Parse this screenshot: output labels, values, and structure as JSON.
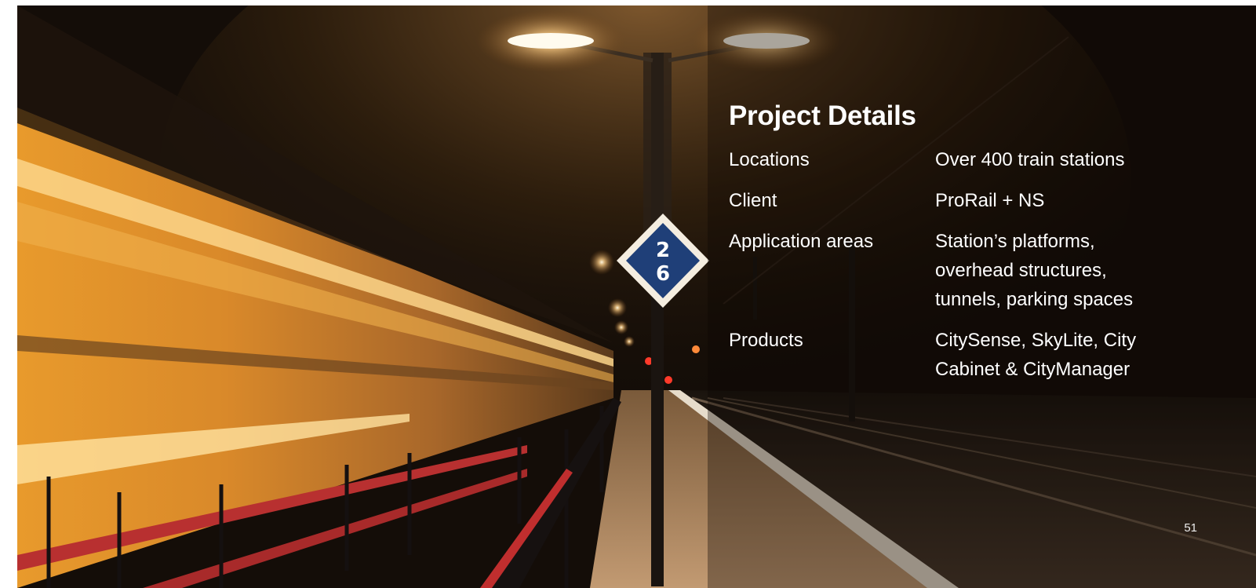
{
  "slide": {
    "title": "Project Details",
    "page_number": "51",
    "details": [
      {
        "label": "Locations",
        "value": "Over 400 train stations"
      },
      {
        "label": "Client",
        "value": "ProRail + NS"
      },
      {
        "label": "Application areas",
        "value": "Station’s platforms,\noverhead structures,\ntunnels, parking spaces"
      },
      {
        "label": "Products",
        "value": "CitySense, SkyLite, City\nCabinet & CityManager"
      }
    ],
    "platform_sign": {
      "line1": "2",
      "line2": "6"
    }
  }
}
